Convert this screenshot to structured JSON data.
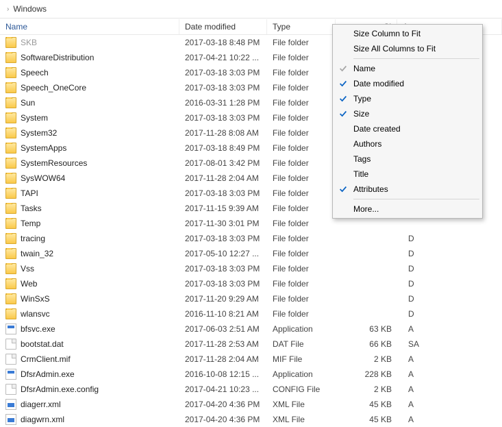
{
  "breadcrumb": {
    "label": "Windows"
  },
  "columns": {
    "name": "Name",
    "date": "Date modified",
    "type": "Type",
    "size": "Si",
    "attr": "Att"
  },
  "rows": [
    {
      "icon": "folder",
      "name": "SKB",
      "date": "2017-03-18 8:48 PM",
      "type": "File folder",
      "size": "",
      "attr": "",
      "dim": true
    },
    {
      "icon": "folder",
      "name": "SoftwareDistribution",
      "date": "2017-04-21 10:22 ...",
      "type": "File folder",
      "size": "",
      "attr": ""
    },
    {
      "icon": "folder",
      "name": "Speech",
      "date": "2017-03-18 3:03 PM",
      "type": "File folder",
      "size": "",
      "attr": ""
    },
    {
      "icon": "folder",
      "name": "Speech_OneCore",
      "date": "2017-03-18 3:03 PM",
      "type": "File folder",
      "size": "",
      "attr": ""
    },
    {
      "icon": "folder",
      "name": "Sun",
      "date": "2016-03-31 1:28 PM",
      "type": "File folder",
      "size": "",
      "attr": ""
    },
    {
      "icon": "folder",
      "name": "System",
      "date": "2017-03-18 3:03 PM",
      "type": "File folder",
      "size": "",
      "attr": ""
    },
    {
      "icon": "folder",
      "name": "System32",
      "date": "2017-11-28 8:08 AM",
      "type": "File folder",
      "size": "",
      "attr": ""
    },
    {
      "icon": "folder",
      "name": "SystemApps",
      "date": "2017-03-18 8:49 PM",
      "type": "File folder",
      "size": "",
      "attr": ""
    },
    {
      "icon": "folder",
      "name": "SystemResources",
      "date": "2017-08-01 3:42 PM",
      "type": "File folder",
      "size": "",
      "attr": ""
    },
    {
      "icon": "folder",
      "name": "SysWOW64",
      "date": "2017-11-28 2:04 AM",
      "type": "File folder",
      "size": "",
      "attr": ""
    },
    {
      "icon": "folder",
      "name": "TAPI",
      "date": "2017-03-18 3:03 PM",
      "type": "File folder",
      "size": "",
      "attr": ""
    },
    {
      "icon": "folder",
      "name": "Tasks",
      "date": "2017-11-15 9:39 AM",
      "type": "File folder",
      "size": "",
      "attr": ""
    },
    {
      "icon": "folder",
      "name": "Temp",
      "date": "2017-11-30 3:01 PM",
      "type": "File folder",
      "size": "",
      "attr": ""
    },
    {
      "icon": "folder",
      "name": "tracing",
      "date": "2017-03-18 3:03 PM",
      "type": "File folder",
      "size": "",
      "attr": "D"
    },
    {
      "icon": "folder",
      "name": "twain_32",
      "date": "2017-05-10 12:27 ...",
      "type": "File folder",
      "size": "",
      "attr": "D"
    },
    {
      "icon": "folder",
      "name": "Vss",
      "date": "2017-03-18 3:03 PM",
      "type": "File folder",
      "size": "",
      "attr": "D"
    },
    {
      "icon": "folder",
      "name": "Web",
      "date": "2017-03-18 3:03 PM",
      "type": "File folder",
      "size": "",
      "attr": "D"
    },
    {
      "icon": "folder",
      "name": "WinSxS",
      "date": "2017-11-20 9:29 AM",
      "type": "File folder",
      "size": "",
      "attr": "D"
    },
    {
      "icon": "folder",
      "name": "wlansvc",
      "date": "2016-11-10 8:21 AM",
      "type": "File folder",
      "size": "",
      "attr": "D"
    },
    {
      "icon": "app",
      "name": "bfsvc.exe",
      "date": "2017-06-03 2:51 AM",
      "type": "Application",
      "size": "63 KB",
      "attr": "A"
    },
    {
      "icon": "file",
      "name": "bootstat.dat",
      "date": "2017-11-28 2:53 AM",
      "type": "DAT File",
      "size": "66 KB",
      "attr": "SA"
    },
    {
      "icon": "file",
      "name": "CrmClient.mif",
      "date": "2017-11-28 2:04 AM",
      "type": "MIF File",
      "size": "2 KB",
      "attr": "A"
    },
    {
      "icon": "app",
      "name": "DfsrAdmin.exe",
      "date": "2016-10-08 12:15 ...",
      "type": "Application",
      "size": "228 KB",
      "attr": "A"
    },
    {
      "icon": "file",
      "name": "DfsrAdmin.exe.config",
      "date": "2017-04-21 10:23 ...",
      "type": "CONFIG File",
      "size": "2 KB",
      "attr": "A"
    },
    {
      "icon": "xml",
      "name": "diagerr.xml",
      "date": "2017-04-20 4:36 PM",
      "type": "XML File",
      "size": "45 KB",
      "attr": "A"
    },
    {
      "icon": "xml",
      "name": "diagwrn.xml",
      "date": "2017-04-20 4:36 PM",
      "type": "XML File",
      "size": "45 KB",
      "attr": "A"
    }
  ],
  "menu": {
    "size_to_fit": "Size Column to Fit",
    "size_all": "Size All Columns to Fit",
    "items": [
      {
        "label": "Name",
        "checked": "gray"
      },
      {
        "label": "Date modified",
        "checked": "blue"
      },
      {
        "label": "Type",
        "checked": "blue"
      },
      {
        "label": "Size",
        "checked": "blue"
      },
      {
        "label": "Date created",
        "checked": ""
      },
      {
        "label": "Authors",
        "checked": ""
      },
      {
        "label": "Tags",
        "checked": ""
      },
      {
        "label": "Title",
        "checked": ""
      },
      {
        "label": "Attributes",
        "checked": "blue"
      }
    ],
    "more": "More..."
  }
}
